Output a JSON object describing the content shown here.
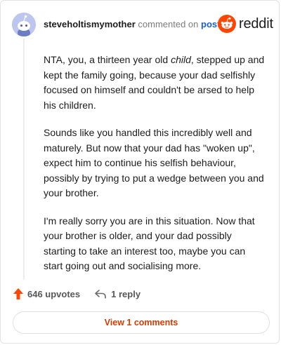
{
  "comment": {
    "username": "steveholtismymother",
    "commented_on_text": "commented on",
    "post_link": "post",
    "paragraphs": [
      {
        "before": "NTA, you, a thirteen year old ",
        "italic": "child",
        "after": ", stepped up and kept the family going, because your dad selfishly focused on himself and couldn't be arsed to help his children."
      },
      {
        "text": "Sounds like you handled this incredibly well and maturely. But now that your dad has \"woken up\", expect him to continue his selfish behaviour, possibly by trying to put a wedge between you and your brother."
      },
      {
        "text": "I'm really sorry you are in this situation. Now that your brother is older, and your dad possibly starting to take an interest too, maybe you can start going out and socialising more."
      }
    ]
  },
  "brand": {
    "wordmark": "reddit",
    "color": "#ff4500"
  },
  "actions": {
    "upvotes": "646 upvotes",
    "replies": "1 reply"
  },
  "view_comments": "View 1 comments",
  "icons": {
    "avatar": "snoo-avatar-icon",
    "logo": "reddit-logo-icon",
    "upvote": "upvote-arrow-icon",
    "reply": "reply-arrow-icon"
  }
}
